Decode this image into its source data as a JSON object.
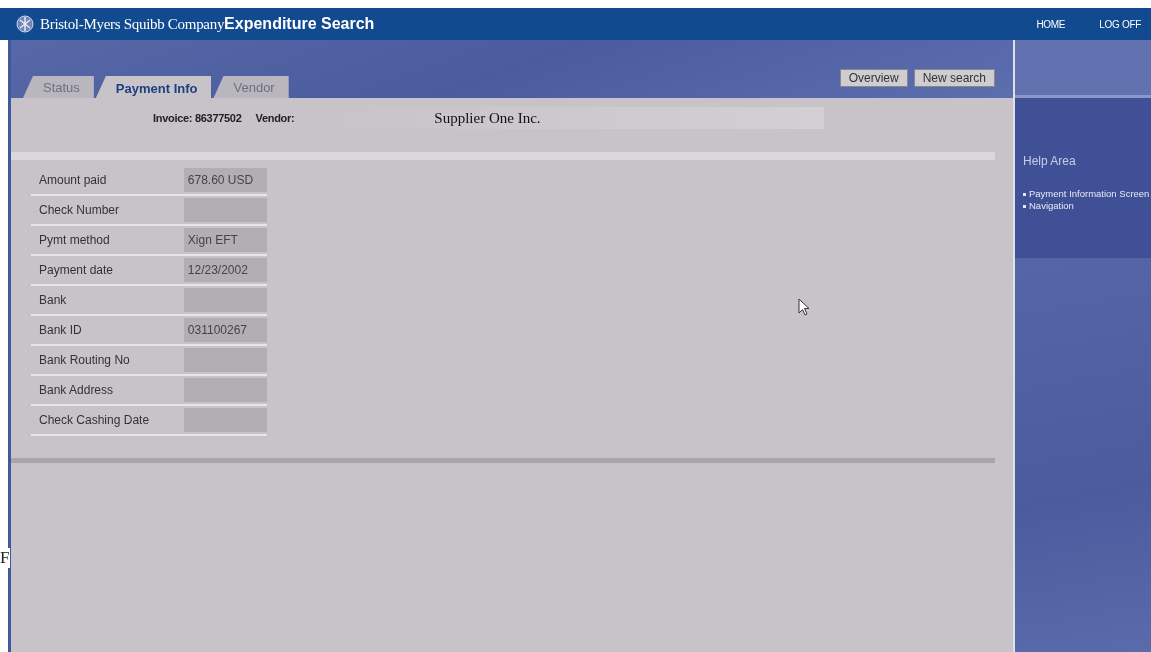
{
  "header": {
    "company": "Bristol-Myers Squibb Company",
    "title": "Expenditure Search",
    "links": [
      "HOME",
      "LOG OFF"
    ]
  },
  "tabs": [
    {
      "label": "Status",
      "selected": false
    },
    {
      "label": "Payment Info",
      "selected": true
    },
    {
      "label": "Vendor",
      "selected": false
    }
  ],
  "buttons": [
    "Overview",
    "New search"
  ],
  "summary": {
    "invoice": "Invoice: 86377502",
    "vendor_label": "Vendor:",
    "vendor_value": "Supplier One Inc."
  },
  "fields": [
    {
      "label": "Amount paid",
      "value": "678.60 USD"
    },
    {
      "label": "Check Number"
    },
    {
      "label": "Pymt method",
      "value": "Xign EFT"
    },
    {
      "label": "Payment date",
      "value": "12/23/2002"
    },
    {
      "label": "Bank"
    },
    {
      "label": "Bank ID",
      "value": "031100267"
    },
    {
      "label": "Bank Routing No"
    },
    {
      "label": "Bank Address"
    },
    {
      "label": "Check Cashing Date"
    }
  ],
  "help": {
    "title": "Help Area",
    "items": [
      "Payment Information Screen",
      "Navigation"
    ]
  },
  "stray_text": "F"
}
